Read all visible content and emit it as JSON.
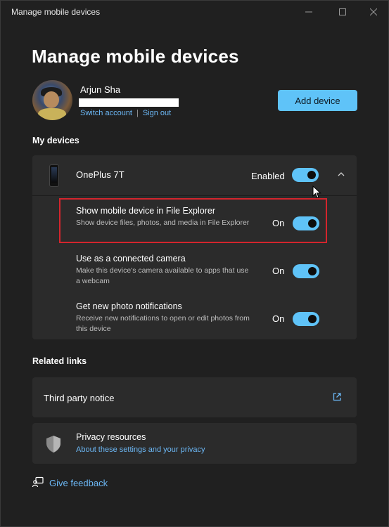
{
  "window": {
    "title": "Manage mobile devices",
    "controls": [
      "minimize-icon",
      "maximize-icon",
      "close-icon"
    ]
  },
  "page": {
    "heading": "Manage mobile devices"
  },
  "account": {
    "name": "Arjun Sha",
    "switch_account": "Switch account",
    "separator": "|",
    "sign_out": "Sign out",
    "add_device": "Add device"
  },
  "my_devices": {
    "label": "My devices",
    "device": {
      "name": "OnePlus 7T",
      "status": "Enabled",
      "enabled": true
    },
    "settings": [
      {
        "title": "Show mobile device in File Explorer",
        "description": "Show device files, photos, and media in File Explorer",
        "state": "On",
        "on": true
      },
      {
        "title": "Use as a connected camera",
        "description": "Make this device's camera available to apps that use a webcam",
        "state": "On",
        "on": true
      },
      {
        "title": "Get new photo notifications",
        "description": "Receive new notifications to open or edit photos from this device",
        "state": "On",
        "on": true
      }
    ]
  },
  "related_links": {
    "label": "Related links",
    "third_party": "Third party notice",
    "privacy_title": "Privacy resources",
    "privacy_link": "About these settings and your privacy"
  },
  "feedback": {
    "label": "Give feedback"
  },
  "colors": {
    "accent": "#5fc3f8",
    "link": "#6cb8f6",
    "highlight_box": "#d4252d",
    "background": "#202020",
    "card": "#2b2b2b"
  }
}
